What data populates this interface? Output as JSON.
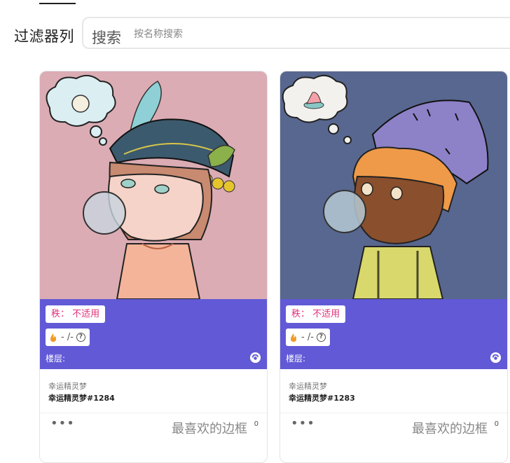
{
  "filter": {
    "label": "过滤器列"
  },
  "search": {
    "label": "搜索",
    "placeholder": "按名称搜索"
  },
  "cards": [
    {
      "rarity": "秩： 不适用",
      "stats": "- /-",
      "floor": "楼层:",
      "collection": "幸运精灵梦",
      "name": "幸运精灵梦#1284",
      "more": "•••",
      "favorite_label": "最喜欢的边框",
      "favorite_count": "0"
    },
    {
      "rarity": "秩： 不适用",
      "stats": "- /-",
      "floor": "楼层:",
      "collection": "幸运精灵梦",
      "name": "幸运精灵梦#1283",
      "more": "•••",
      "favorite_label": "最喜欢的边框",
      "favorite_count": "0"
    }
  ],
  "colors": {
    "band": "#6159d6",
    "rarity_text": "#e0307a",
    "card1_bg": "#dbacb4",
    "card2_bg": "#58678f"
  },
  "icons": [
    "flame-icon",
    "help-icon",
    "refresh-swirl-icon",
    "more-icon"
  ]
}
